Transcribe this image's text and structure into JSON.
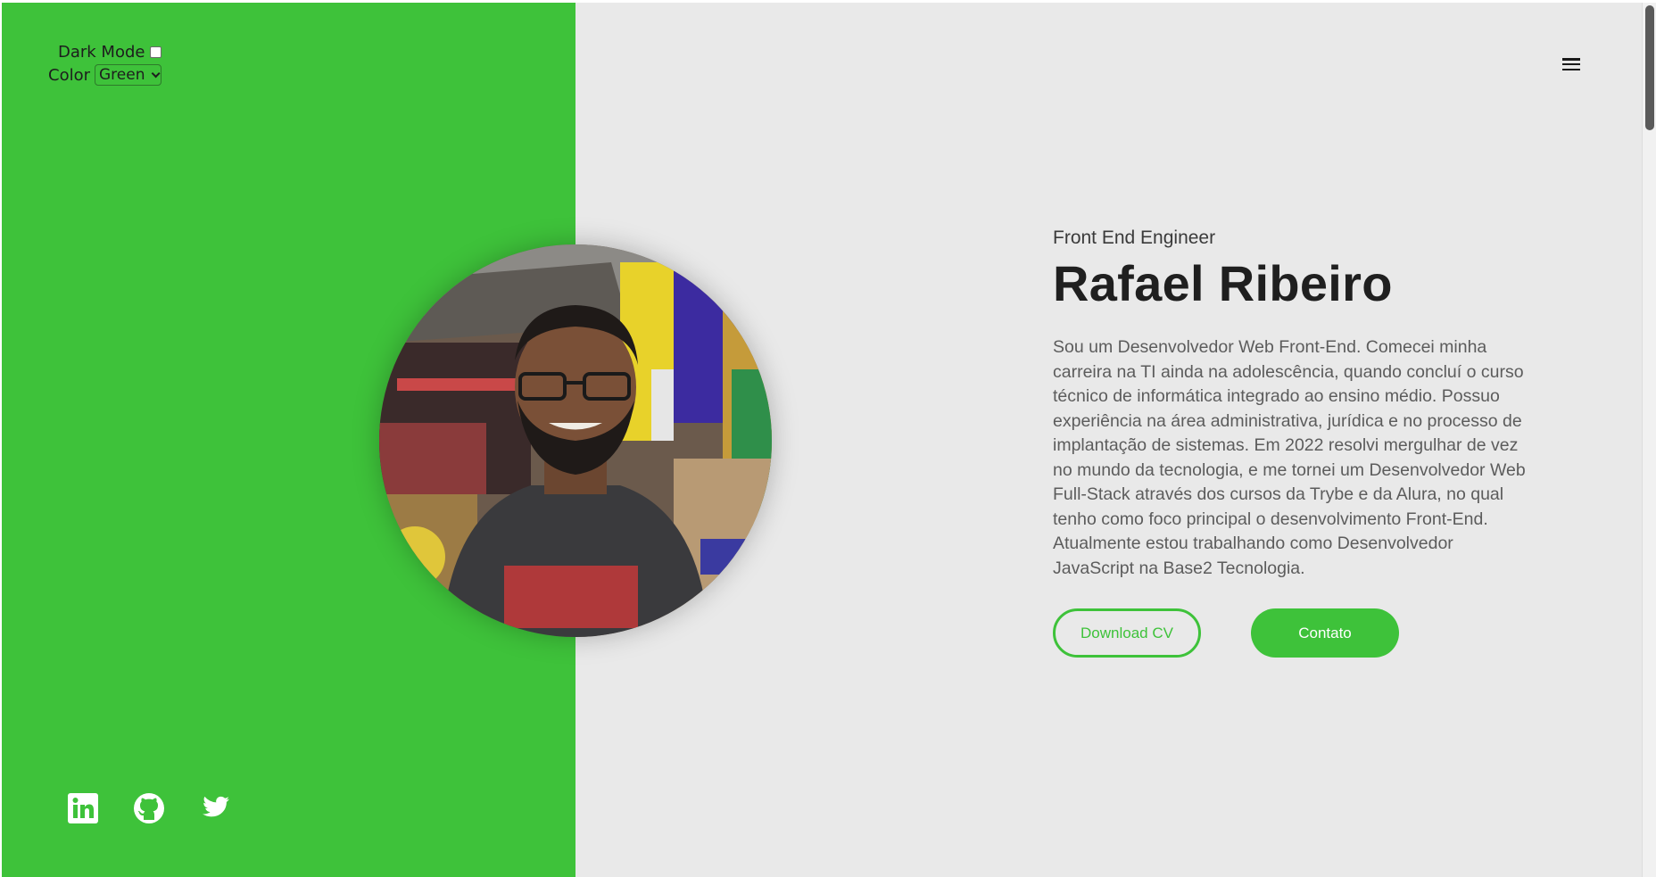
{
  "settings": {
    "dark_mode_label": "Dark Mode",
    "dark_mode_checked": false,
    "color_label": "Color",
    "color_selected": "Green"
  },
  "menu": {
    "icon": "hamburger-menu-icon"
  },
  "hero": {
    "role": "Front End Engineer",
    "name": "Rafael Ribeiro",
    "bio": "Sou um Desenvolvedor Web Front-End. Comecei minha carreira na TI ainda na adolescência, quando concluí o curso técnico de informática integrado ao ensino médio. Possuo experiência na área administrativa, jurídica e no processo de implantação de sistemas. Em 2022 resolvi mergulhar de vez no mundo da tecnologia, e me tornei um Desenvolvedor Web Full-Stack através dos cursos da Trybe e da Alura, no qual tenho como foco principal o desenvolvimento Front-End. Atualmente estou trabalhando como Desenvolvedor JavaScript na Base2 Tecnologia.",
    "download_cv_label": "Download CV",
    "contact_label": "Contato"
  },
  "social": {
    "icons": [
      "linkedin-icon",
      "github-icon",
      "twitter-icon"
    ]
  },
  "colors": {
    "accent": "#3ec23a",
    "background": "#e9e9e9",
    "text_dark": "#1f1f1f",
    "text_muted": "#5c5c5c"
  }
}
